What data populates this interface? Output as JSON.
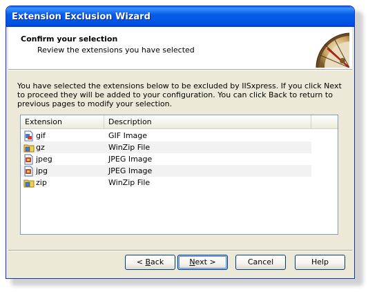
{
  "window": {
    "title": "Extension Exclusion Wizard"
  },
  "header": {
    "title": "Confirm your selection",
    "subtitle": "Review the extensions you have selected"
  },
  "intro_text": "You have selected the extensions below to be excluded by IISxpress. If you click Next to proceed they will be added to your configuration. You can click Back to return to previous pages to modify your selection.",
  "list": {
    "columns": [
      "Extension",
      "Description"
    ],
    "rows": [
      {
        "extension": "gif",
        "description": "GIF Image",
        "icon": "gif-image-icon"
      },
      {
        "extension": "gz",
        "description": "WinZip File",
        "icon": "winzip-folder-icon"
      },
      {
        "extension": "jpeg",
        "description": "JPEG Image",
        "icon": "jpeg-image-icon"
      },
      {
        "extension": "jpg",
        "description": "JPEG Image",
        "icon": "jpeg-image-icon"
      },
      {
        "extension": "zip",
        "description": "WinZip File",
        "icon": "winzip-folder-icon"
      }
    ]
  },
  "buttons": {
    "back_prefix": "< ",
    "back_mnemonic": "B",
    "back_rest": "ack",
    "next_mnemonic": "N",
    "next_rest": "ext >",
    "cancel": "Cancel",
    "help": "Help"
  },
  "colors": {
    "titlebar": "#0054e3",
    "dialog_bg": "#ece9d8",
    "list_border": "#7f9db9"
  }
}
